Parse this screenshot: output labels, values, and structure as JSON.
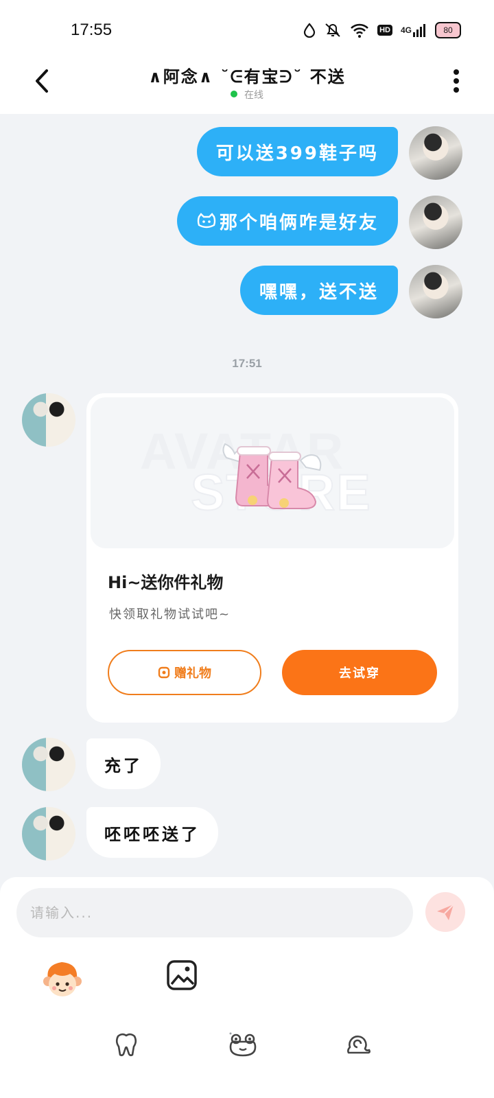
{
  "status_bar": {
    "time": "17:55",
    "hd": "HD",
    "network": "4G",
    "battery": "80"
  },
  "header": {
    "title": "∧阿念∧ ˘ᕮ有宝ᕭ˘ 不送",
    "status": "在线"
  },
  "messages_out": [
    {
      "text": "可以送399鞋子吗"
    },
    {
      "text": "那个咱俩咋是好友",
      "prefix_icon": "cat-face-emoji"
    },
    {
      "text": "嘿嘿，送不送"
    }
  ],
  "timestamp": "17:51",
  "gift_card": {
    "watermark_line1": "AVATAR",
    "watermark_line2": "STORE",
    "title": "Hi~送你件礼物",
    "subtitle": "快领取礼物试试吧~",
    "gift_button": "赠礼物",
    "try_button": "去试穿"
  },
  "messages_in": [
    {
      "text": "充了"
    },
    {
      "text": "呸呸呸送了"
    }
  ],
  "input": {
    "placeholder": "请输入..."
  },
  "colors": {
    "bubble_out": "#2db0f7",
    "accent_orange": "#fb7417",
    "online_dot": "#1ec24a",
    "background": "#f1f3f6"
  },
  "icons": {
    "toolbar": [
      "sticker-monkey-icon",
      "image-icon"
    ],
    "bottom_nav": [
      "tooth-icon",
      "frog-icon",
      "snail-icon"
    ]
  }
}
